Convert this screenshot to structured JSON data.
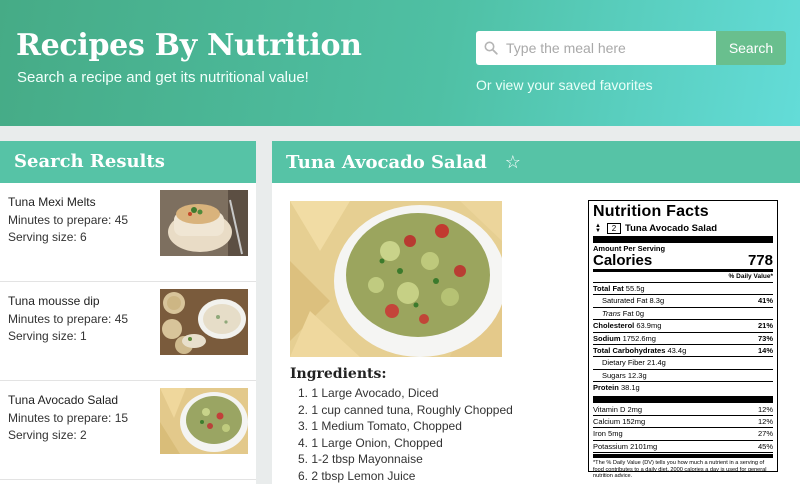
{
  "header": {
    "title": "Recipes By Nutrition",
    "subtitle": "Search a recipe and get its nutritional value!",
    "search_placeholder": "Type the meal here",
    "search_button": "Search",
    "favorites_link": "Or view your saved favorites"
  },
  "results": {
    "title": "Search Results",
    "items": [
      {
        "name": "Tuna Mexi Melts",
        "minutes": "Minutes to prepare: 45",
        "serving": "Serving size: 6"
      },
      {
        "name": "Tuna mousse dip",
        "minutes": "Minutes to prepare: 45",
        "serving": "Serving size: 1"
      },
      {
        "name": "Tuna Avocado Salad",
        "minutes": "Minutes to prepare: 15",
        "serving": "Serving size: 2"
      }
    ]
  },
  "detail": {
    "title": "Tuna Avocado Salad",
    "star": "☆",
    "ingredients_title": "Ingredients:",
    "ingredients": [
      "1. 1 Large Avocado, Diced",
      "2. 1 cup canned tuna, Roughly Chopped",
      "3. 1 Medium Tomato, Chopped",
      "4. 1 Large Onion, Chopped",
      "5. 1-2 tbsp Mayonnaise",
      "6. 2 tbsp Lemon Juice"
    ]
  },
  "nutrition": {
    "title": "Nutrition Facts",
    "serving_qty": "2",
    "serving_name": "Tuna Avocado Salad",
    "amount_per_serving": "Amount Per Serving",
    "calories_label": "Calories",
    "calories_value": "778",
    "dv_header": "% Daily Value*",
    "total_fat": {
      "label": "Total Fat",
      "amount": "55.5g"
    },
    "saturated_fat": {
      "label": "Saturated Fat",
      "amount": "8.3g",
      "pct": "41%"
    },
    "trans_fat": {
      "label": "Trans",
      "suffix": "Fat",
      "amount": "0g"
    },
    "cholesterol": {
      "label": "Cholesterol",
      "amount": "63.9mg",
      "pct": "21%"
    },
    "sodium": {
      "label": "Sodium",
      "amount": "1752.6mg",
      "pct": "73%"
    },
    "carbs": {
      "label": "Total Carbohydrates",
      "amount": "43.4g",
      "pct": "14%"
    },
    "fiber": {
      "label": "Dietary Fiber",
      "amount": "21.4g"
    },
    "sugars": {
      "label": "Sugars",
      "amount": "12.3g"
    },
    "protein": {
      "label": "Protein",
      "amount": "38.1g"
    },
    "vitamins": [
      {
        "label": "Vitamin D",
        "amount": "2mg",
        "pct": "12%"
      },
      {
        "label": "Calcium",
        "amount": "152mg",
        "pct": "12%"
      },
      {
        "label": "Iron",
        "amount": "5mg",
        "pct": "27%"
      },
      {
        "label": "Potassium",
        "amount": "2101mg",
        "pct": "45%"
      }
    ],
    "footnote": "*The % Daily Value (DV) tells you how much a nutrient in a serving of food contributes to a daily diet. 2000 calories a day is used for general nutrition advice."
  },
  "colors": {
    "header_start": "#46ab86",
    "header_end": "#63dcd8",
    "panel_header": "#56c3a6",
    "search_button": "#69bf8e"
  },
  "icons": {
    "search": "search-icon",
    "favorite": "star-outline-icon",
    "stepper": "stepper-icon"
  }
}
